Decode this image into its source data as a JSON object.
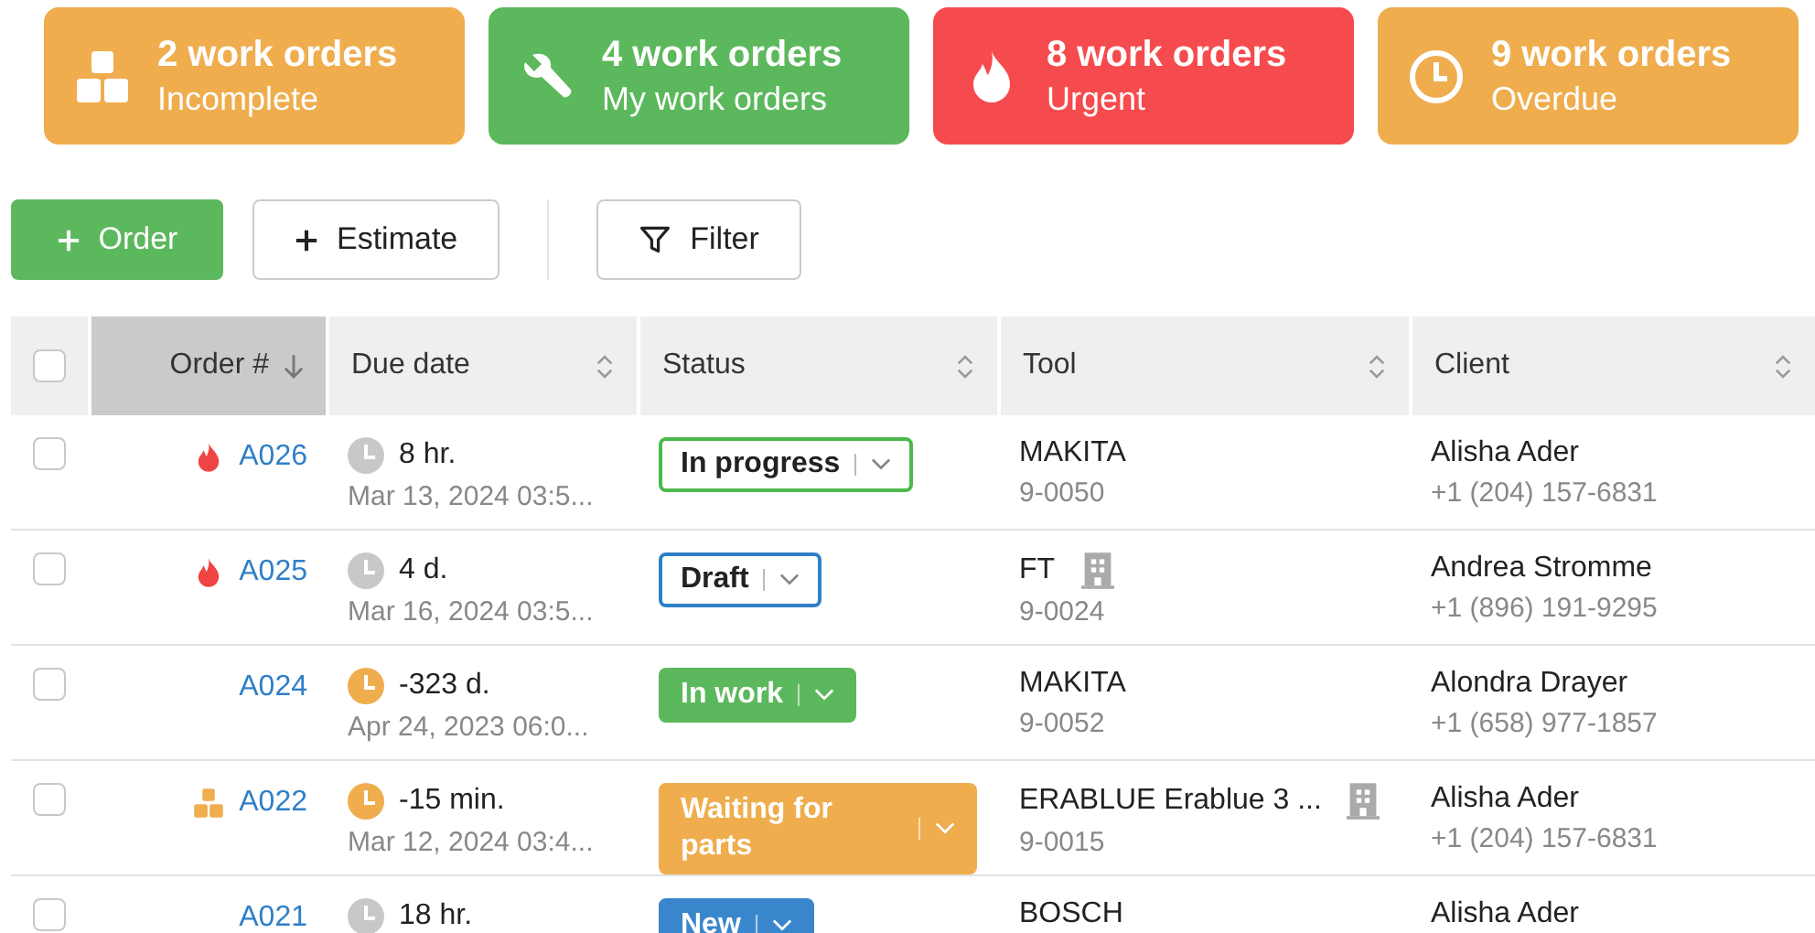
{
  "summary_cards": [
    {
      "kind": "boxes",
      "color": "#efad4e",
      "count": "2 work orders",
      "label": "Incomplete"
    },
    {
      "kind": "wrench",
      "color": "#5cb85c",
      "count": "4 work orders",
      "label": "My work orders"
    },
    {
      "kind": "fire",
      "color": "#f64b4e",
      "count": "8 work orders",
      "label": "Urgent"
    },
    {
      "kind": "clock",
      "color": "#efad4e",
      "count": "9 work orders",
      "label": "Overdue"
    }
  ],
  "toolbar": [
    {
      "kind": "primary",
      "label": "Order"
    },
    {
      "kind": "add",
      "label": "Estimate"
    },
    {
      "kind": "divider"
    },
    {
      "kind": "filter",
      "label": "Filter"
    }
  ],
  "table": {
    "select_all": {
      "checked": false
    },
    "columns": [
      {
        "label": "Order #",
        "selected": true
      },
      {
        "label": "Due date",
        "selected": false
      },
      {
        "label": "Status",
        "selected": false
      },
      {
        "label": "Tool",
        "selected": false
      },
      {
        "label": "Client",
        "selected": false
      }
    ],
    "rows": [
      {
        "checked": false,
        "urgent": true,
        "incomplete": false,
        "order": "A026",
        "overdue": false,
        "due": "8 hr.",
        "date": "Mar 13, 2024 03:5...",
        "status": {
          "label": "In progress",
          "color": "#4cb84c",
          "outlined": true
        },
        "tool": "MAKITA",
        "tool_code": "9-0050",
        "tool_building": false,
        "client": "Alisha Ader",
        "phone": "+1 (204) 157-6831"
      },
      {
        "checked": false,
        "urgent": true,
        "incomplete": false,
        "order": "A025",
        "overdue": false,
        "due": "4 d.",
        "date": "Mar 16, 2024 03:5...",
        "status": {
          "label": "Draft",
          "color": "#2f7fc8",
          "outlined": true
        },
        "tool": "FT",
        "tool_code": "9-0024",
        "tool_building": true,
        "client": "Andrea Stromme",
        "phone": "+1 (896) 191-9295"
      },
      {
        "checked": false,
        "urgent": false,
        "incomplete": false,
        "order": "A024",
        "overdue": true,
        "due": "-323 d.",
        "date": "Apr 24, 2023 06:0...",
        "status": {
          "label": "In work",
          "color": "#5cb85c",
          "outlined": false
        },
        "tool": "MAKITA",
        "tool_code": "9-0052",
        "tool_building": false,
        "client": "Alondra Drayer",
        "phone": "+1 (658) 977-1857"
      },
      {
        "checked": false,
        "urgent": false,
        "incomplete": true,
        "order": "A022",
        "overdue": true,
        "due": "-15 min.",
        "date": "Mar 12, 2024 03:4...",
        "status": {
          "label": "Waiting for parts",
          "color": "#efad4e",
          "outlined": false
        },
        "tool": "ERABLUE Erablue 3 ...",
        "tool_code": "9-0015",
        "tool_building": true,
        "client": "Alisha Ader",
        "phone": "+1 (204) 157-6831"
      },
      {
        "checked": false,
        "urgent": false,
        "incomplete": false,
        "order": "A021",
        "overdue": false,
        "due": "18 hr.",
        "status": {
          "label": "New",
          "color": "#3a86cc",
          "outlined": false
        },
        "tool": "BOSCH",
        "tool_building": false,
        "client": "Alisha Ader"
      }
    ]
  }
}
